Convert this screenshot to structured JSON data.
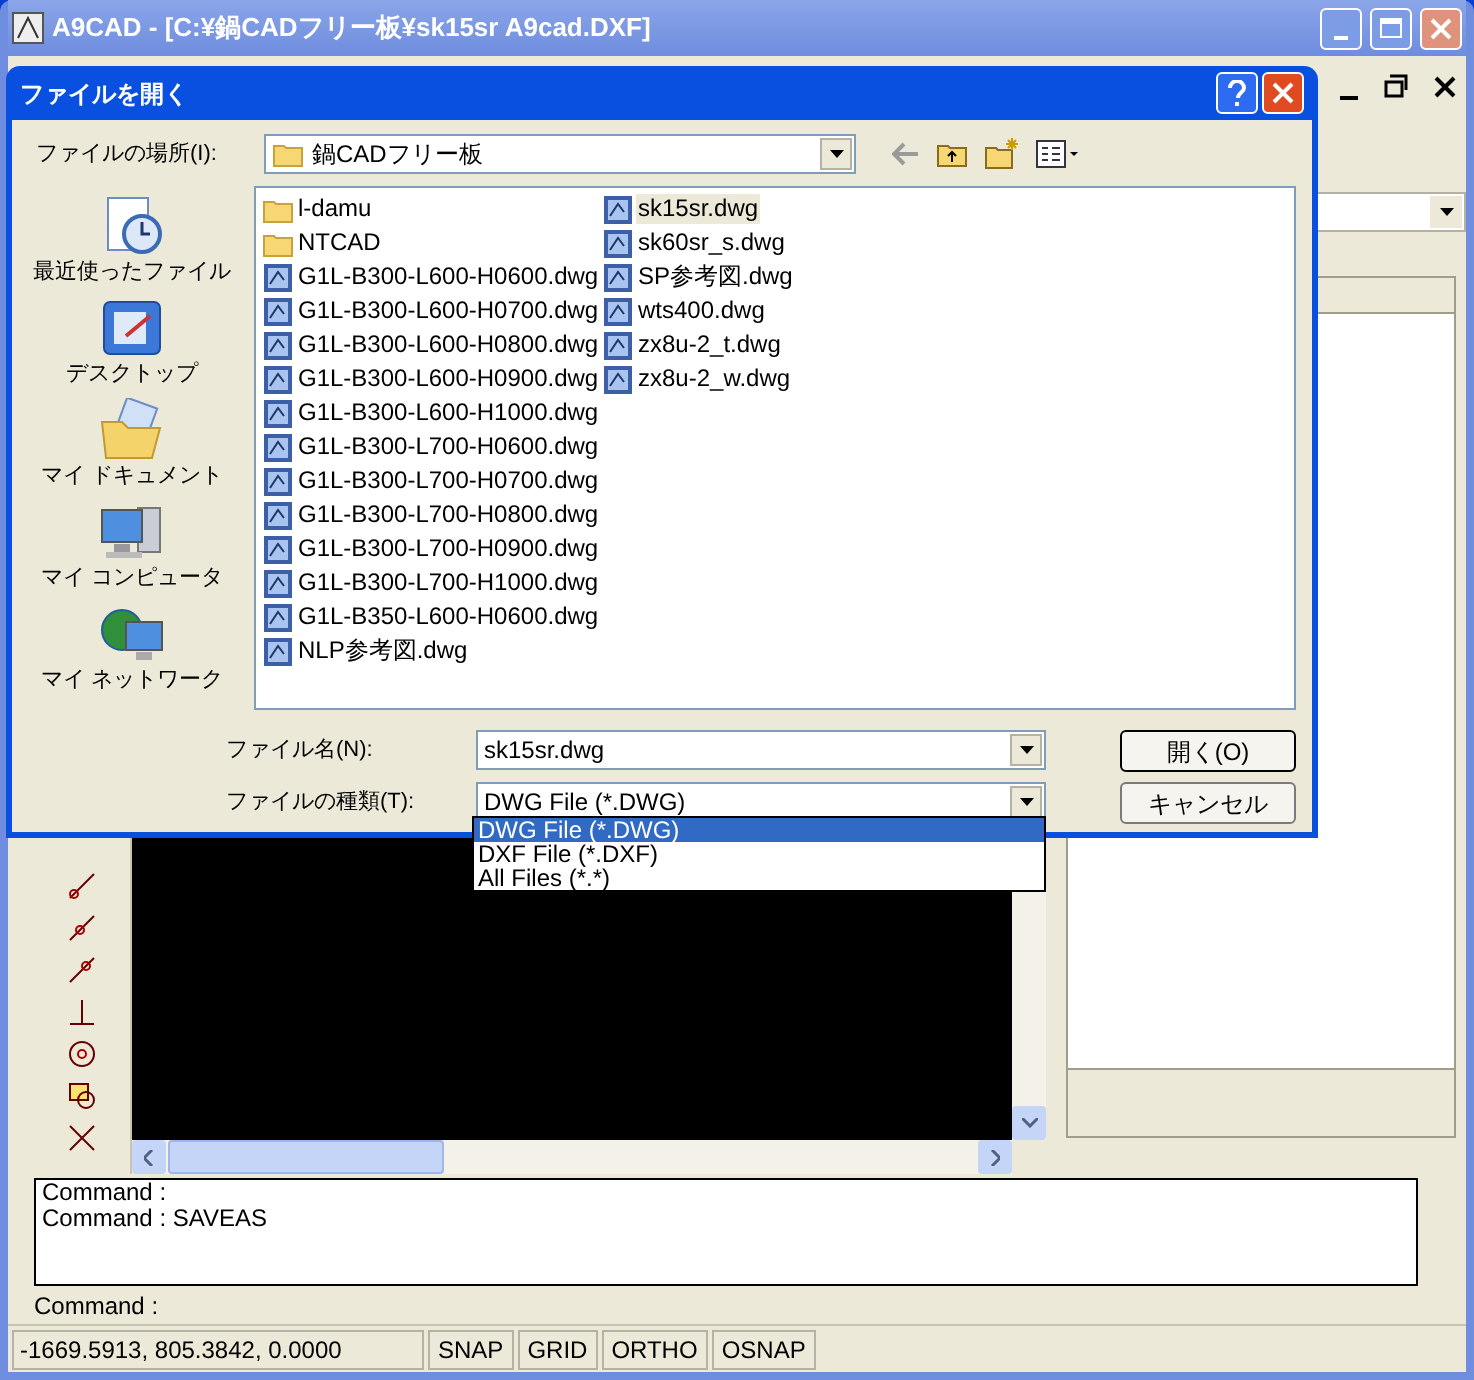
{
  "window": {
    "title": "A9CAD - [C:¥鍋CADフリー板¥sk15sr A9cad.DXF]"
  },
  "dialog": {
    "title": "ファイルを開く",
    "look_in_label": "ファイルの場所(I):",
    "look_in_value": "鍋CADフリー板",
    "places": [
      {
        "kind": "recent",
        "label": "最近使ったファイル"
      },
      {
        "kind": "desktop",
        "label": "デスクトップ"
      },
      {
        "kind": "documents",
        "label": "マイ ドキュメント"
      },
      {
        "kind": "computer",
        "label": "マイ コンピュータ"
      },
      {
        "kind": "network",
        "label": "マイ ネットワーク"
      }
    ],
    "files": [
      {
        "kind": "folder",
        "name": "l-damu",
        "selected": false
      },
      {
        "kind": "folder",
        "name": "NTCAD",
        "selected": false
      },
      {
        "kind": "drawing",
        "name": "G1L-B300-L600-H0600.dwg",
        "selected": false
      },
      {
        "kind": "drawing",
        "name": "G1L-B300-L600-H0700.dwg",
        "selected": false
      },
      {
        "kind": "drawing",
        "name": "G1L-B300-L600-H0800.dwg",
        "selected": false
      },
      {
        "kind": "drawing",
        "name": "G1L-B300-L600-H0900.dwg",
        "selected": false
      },
      {
        "kind": "drawing",
        "name": "G1L-B300-L600-H1000.dwg",
        "selected": false
      },
      {
        "kind": "drawing",
        "name": "G1L-B300-L700-H0600.dwg",
        "selected": false
      },
      {
        "kind": "drawing",
        "name": "G1L-B300-L700-H0700.dwg",
        "selected": false
      },
      {
        "kind": "drawing",
        "name": "G1L-B300-L700-H0800.dwg",
        "selected": false
      },
      {
        "kind": "drawing",
        "name": "G1L-B300-L700-H0900.dwg",
        "selected": false
      },
      {
        "kind": "drawing",
        "name": "G1L-B300-L700-H1000.dwg",
        "selected": false
      },
      {
        "kind": "drawing",
        "name": "G1L-B350-L600-H0600.dwg",
        "selected": false
      },
      {
        "kind": "drawing",
        "name": "NLP参考図.dwg",
        "selected": false
      },
      {
        "kind": "drawing",
        "name": "sk15sr.dwg",
        "selected": true
      },
      {
        "kind": "drawing",
        "name": "sk60sr_s.dwg",
        "selected": false
      },
      {
        "kind": "drawing",
        "name": "SP参考図.dwg",
        "selected": false
      },
      {
        "kind": "drawing",
        "name": "wts400.dwg",
        "selected": false
      },
      {
        "kind": "drawing",
        "name": "zx8u-2_t.dwg",
        "selected": false
      },
      {
        "kind": "drawing",
        "name": "zx8u-2_w.dwg",
        "selected": false
      }
    ],
    "filename_label": "ファイル名(N):",
    "filename_value": "sk15sr.dwg",
    "filetype_label": "ファイルの種類(T):",
    "filetype_value": "DWG File (*.DWG)",
    "filetype_options": [
      {
        "label": "DWG File (*.DWG)",
        "selected": true
      },
      {
        "label": "DXF File (*.DXF)",
        "selected": false
      },
      {
        "label": "All Files (*.*)",
        "selected": false
      }
    ],
    "buttons": [
      "開く(O)",
      "キャンセル"
    ]
  },
  "command": {
    "history": [
      "Command :",
      "Command : SAVEAS"
    ],
    "prompt": "Command :"
  },
  "status_bar": {
    "coordinates": "-1669.5913, 805.3842, 0.0000",
    "toggles": [
      "SNAP",
      "GRID",
      "ORTHO",
      "OSNAP"
    ]
  }
}
